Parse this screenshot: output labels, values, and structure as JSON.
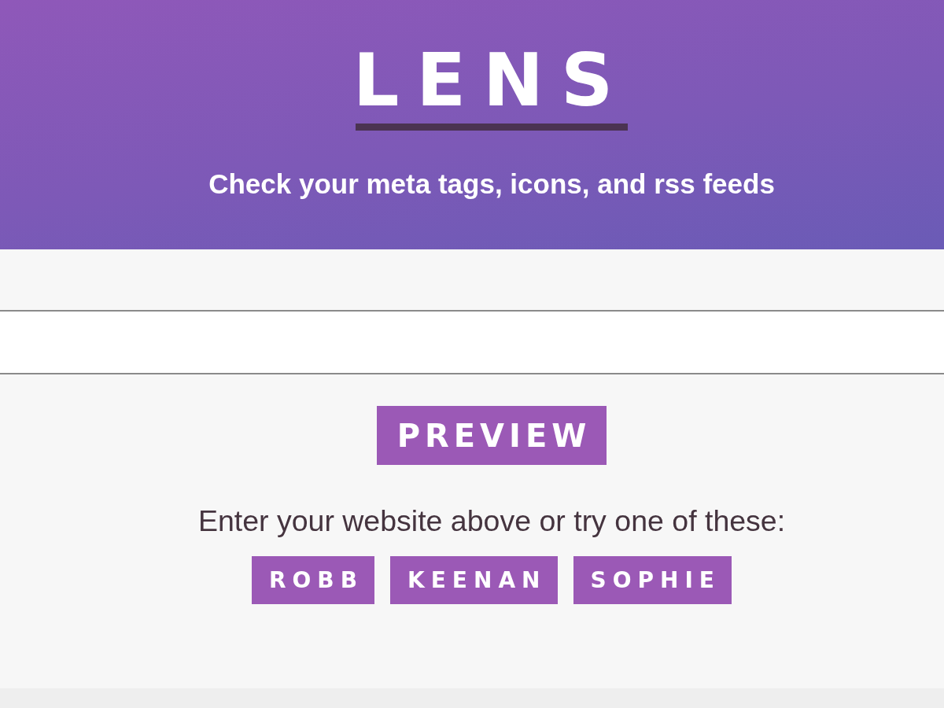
{
  "header": {
    "title": "LENS",
    "tagline": "Check your meta tags, icons, and rss feeds"
  },
  "preview_button": "PREVIEW",
  "prompt": "Enter your website above or try one of these:",
  "examples": [
    "ROBB",
    "KEENAN",
    "SOPHIE"
  ]
}
